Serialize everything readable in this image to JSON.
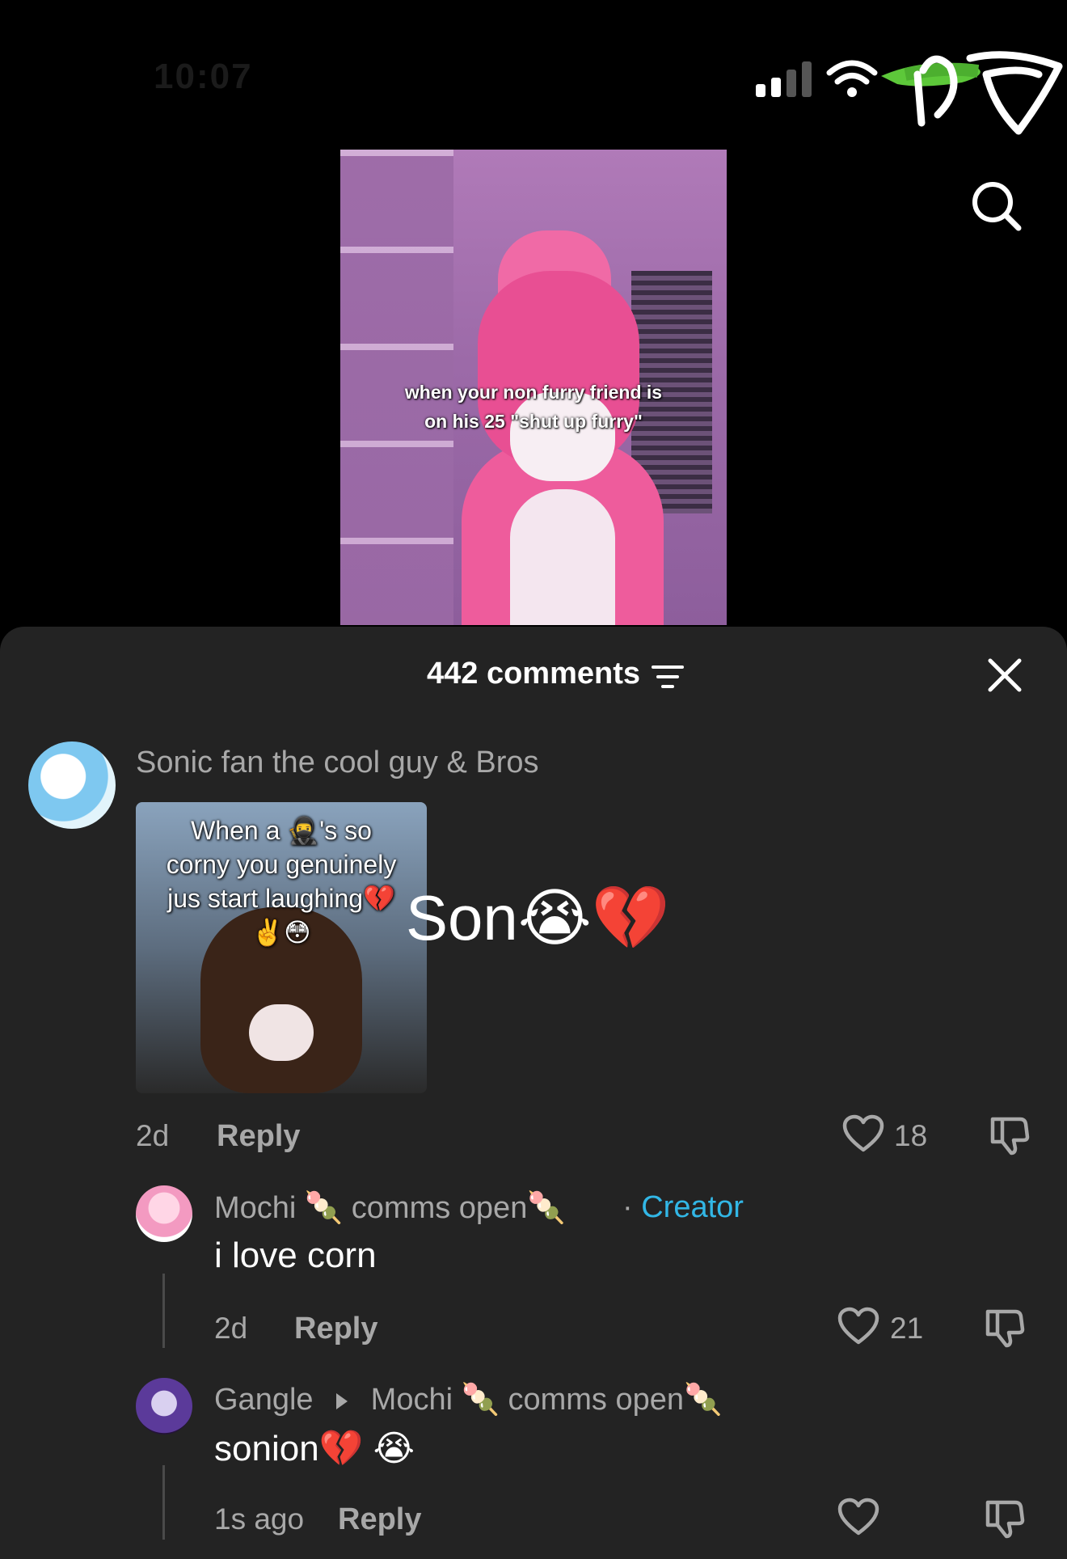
{
  "status_bar": {
    "time": "10:07"
  },
  "video": {
    "caption_line1": "when your non furry friend is",
    "caption_line2": "on his 25 \"shut up furry\""
  },
  "comments_sheet": {
    "title": "442 comments"
  },
  "comments": [
    {
      "username": "Sonic fan the cool guy & Bros",
      "meme_text_line1": "When a 🥷's so",
      "meme_text_line2": "corny you genuinely",
      "meme_text_line3": "jus start laughing💔",
      "meme_emojis": "✌️😳",
      "text": "Son😭💔",
      "time": "2d",
      "reply_label": "Reply",
      "likes": "18"
    },
    {
      "username": "Mochi 🍡 comms open🍡",
      "separator": "·",
      "badge": "Creator",
      "text": "i love corn",
      "time": "2d",
      "reply_label": "Reply",
      "likes": "21"
    },
    {
      "username": "Gangle",
      "reply_to": "Mochi 🍡 comms open🍡",
      "text": "sonion💔 😭",
      "time": "1s ago",
      "reply_label": "Reply",
      "likes": ""
    }
  ],
  "colors": {
    "sheet_bg": "#232323",
    "creator": "#32b7e6",
    "muted": "#a8a8a8"
  },
  "icons": [
    "signal-icon",
    "wifi-icon",
    "battery-icon",
    "search-icon",
    "filter-icon",
    "close-icon",
    "heart-icon",
    "dislike-icon"
  ]
}
